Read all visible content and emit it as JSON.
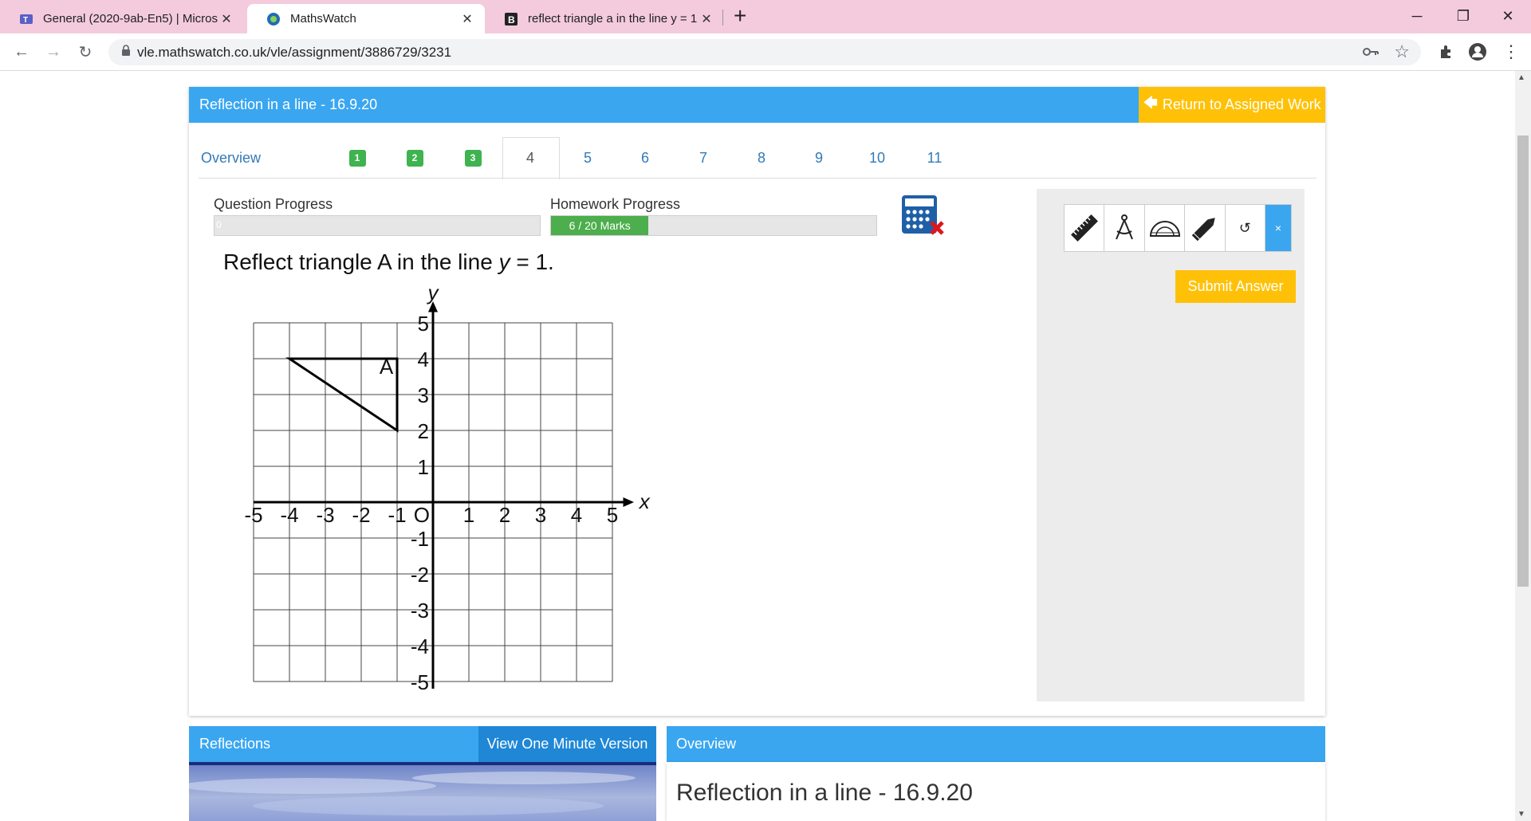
{
  "browser": {
    "tabs": [
      {
        "title": "General (2020-9ab-En5) | Micros",
        "icon": "teams-icon"
      },
      {
        "title": "MathsWatch",
        "icon": "mathswatch-icon"
      },
      {
        "title": "reflect triangle a in the line y = 1",
        "icon": "bing-icon"
      }
    ],
    "new_tab": "+",
    "url": "vle.mathswatch.co.uk/vle/assignment/3886729/3231"
  },
  "assignment": {
    "title": "Reflection in a line - 16.9.20",
    "return_label": "Return to Assigned Work"
  },
  "question_tabs": {
    "overview": "Overview",
    "done": [
      "1",
      "2",
      "3"
    ],
    "current": "4",
    "others": [
      "5",
      "6",
      "7",
      "8",
      "9",
      "10",
      "11"
    ]
  },
  "progress": {
    "question_label": "Question Progress",
    "question_value": "0",
    "question_fraction": 0,
    "homework_label": "Homework Progress",
    "homework_value": "6 / 20 Marks",
    "homework_fraction": 0.3
  },
  "question": {
    "prefix": "Reflect triangle A in the line ",
    "var": "y",
    "suffix": " = 1."
  },
  "graph": {
    "x_axis_label": "x",
    "y_axis_label": "y",
    "origin_label": "O",
    "x_ticks": [
      "-5",
      "-4",
      "-3",
      "-2",
      "-1",
      "1",
      "2",
      "3",
      "4",
      "5"
    ],
    "y_ticks": [
      "5",
      "4",
      "3",
      "2",
      "1",
      "-1",
      "-2",
      "-3",
      "-4",
      "-5"
    ],
    "shape_label": "A",
    "triangle_vertices": [
      [
        -4,
        4
      ],
      [
        -1,
        4
      ],
      [
        -1,
        2
      ]
    ]
  },
  "tools": {
    "items": [
      "ruler-icon",
      "compass-icon",
      "protractor-icon",
      "pencil-icon",
      "undo-icon",
      "close-icon"
    ],
    "close_label": "×",
    "submit_label": "Submit Answer"
  },
  "reflections_panel": {
    "title": "Reflections",
    "button": "View One Minute Version"
  },
  "overview_panel": {
    "title": "Overview",
    "heading": "Reflection in a line - 16.9.20"
  },
  "colors": {
    "brand_blue": "#3aa6f0",
    "accent_yellow": "#ffc107",
    "success_green": "#4cae4c"
  }
}
